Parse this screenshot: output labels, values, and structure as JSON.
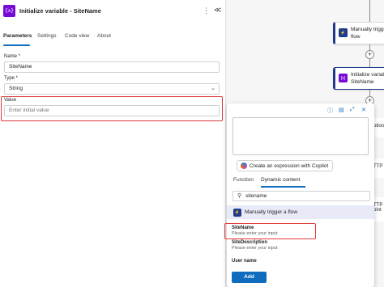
{
  "panel": {
    "action_icon": "{x}",
    "title": "Initialize variable - SiteName",
    "more_icon": "⋮",
    "collapse_icon": "≪",
    "tabs": [
      "Parameters",
      "Settings",
      "Code view",
      "About"
    ],
    "active_tab": "Parameters",
    "fields": {
      "name_label": "Name *",
      "name_value": "SiteName",
      "type_label": "Type *",
      "type_value": "String",
      "value_label": "Value",
      "value_placeholder": "Enter initial value"
    }
  },
  "canvas": {
    "cards": [
      {
        "line1": "Manually trigge",
        "line2": "flow",
        "icon": "person-trigger-icon",
        "color": "#1f3b8a"
      },
      {
        "line1": "Initialize variab",
        "line2": "SiteName",
        "icon": "variable-icon",
        "color": "#770bd6"
      }
    ],
    "partial_labels": [
      "ption",
      "TTP",
      "oint"
    ]
  },
  "popup": {
    "toolbar_icons": [
      "info-icon",
      "page-icon",
      "expand-icon",
      "close-icon"
    ],
    "copilot_label": "Create an expression with Copilot",
    "tabs": [
      "Function",
      "Dynamic content"
    ],
    "active_tab": "Dynamic content",
    "search_value": "sitename",
    "group_label": "Manually trigger a flow",
    "tokens": [
      {
        "title": "SiteName",
        "desc": "Please enter your input"
      },
      {
        "title": "SiteDescription",
        "desc": "Please enter your input"
      },
      {
        "title": "User name",
        "desc": ""
      }
    ],
    "add_label": "Add"
  },
  "colors": {
    "accent": "#0f6cbd",
    "variable": "#770bd6",
    "trigger": "#1f3b8a",
    "highlight": "#e03a3a"
  }
}
